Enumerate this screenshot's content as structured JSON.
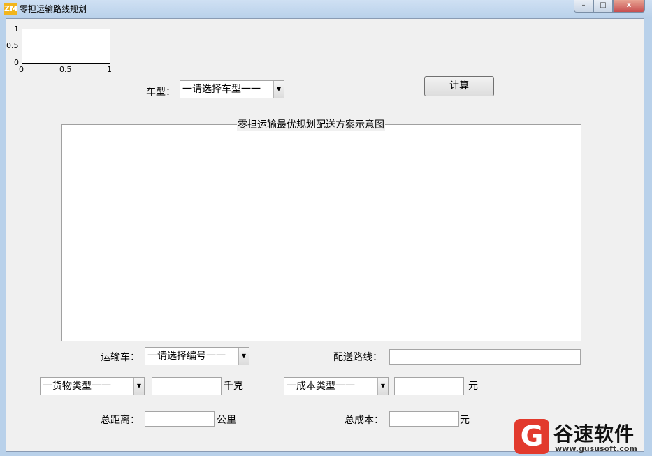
{
  "window": {
    "icon_text": "ZM",
    "title": "零担运输路线规划",
    "controls": {
      "minimize": "–",
      "maximize": "□",
      "close": "x"
    }
  },
  "mini_axes": {
    "y_ticks": [
      "1",
      "0.5",
      "0"
    ],
    "x_ticks": [
      "0",
      "0.5",
      "1"
    ]
  },
  "vehicle_type": {
    "label": "车型：",
    "selected": "一请选择车型一一"
  },
  "calculate_button": "计算",
  "plot_panel": {
    "title": "零担运输最优规划配送方案示意图"
  },
  "transport_vehicle": {
    "label": "运输车：",
    "selected": "一请选择编号一一"
  },
  "delivery_route": {
    "label": "配送路线：",
    "value": ""
  },
  "cargo_type": {
    "selected": "一货物类型一一",
    "value": "",
    "unit": "千克"
  },
  "cost_type": {
    "selected": "一成本类型一一",
    "value": "",
    "unit": "元"
  },
  "total_distance": {
    "label": "总距离：",
    "value": "",
    "unit": "公里"
  },
  "total_cost": {
    "label": "总成本：",
    "value": "",
    "unit": "元"
  },
  "watermark": {
    "logo": "G",
    "name": "谷速软件",
    "url": "www.gususoft.com"
  }
}
